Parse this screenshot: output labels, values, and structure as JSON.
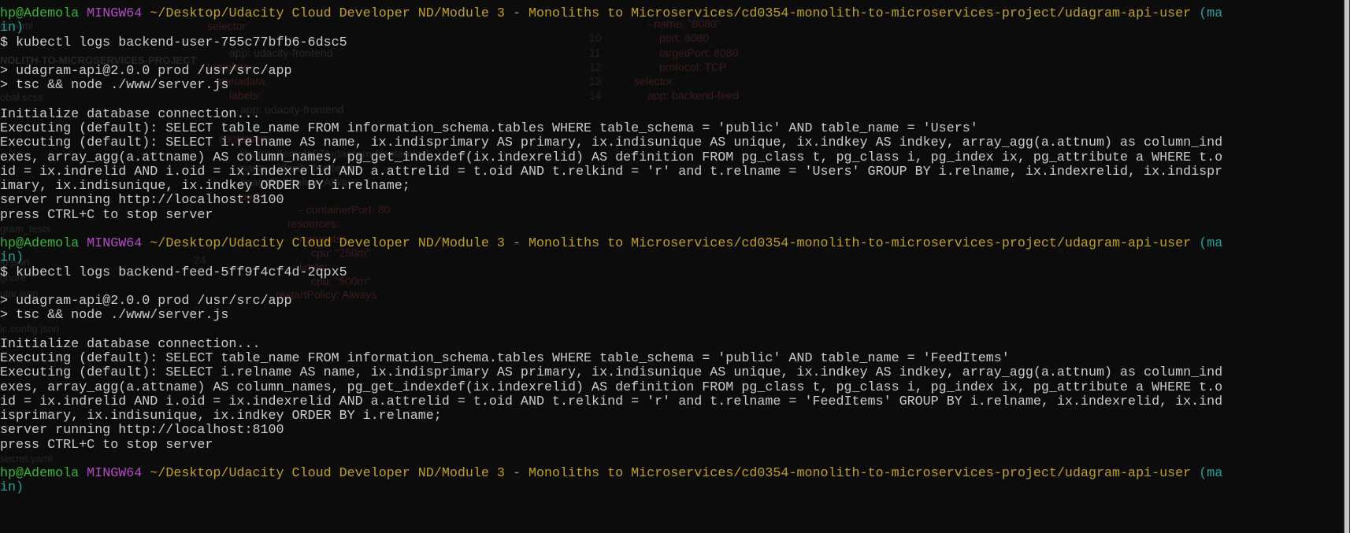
{
  "prompt": {
    "user": "hp@Ademola",
    "system": "MINGW64",
    "path": "~/Desktop/Udacity Cloud Developer ND/Module 3 - Monoliths to Microservices/cd0354-monolith-to-microservices-project/udagram-api-user",
    "branch_start": "(ma",
    "branch_end": "in)"
  },
  "sessions": [
    {
      "command": "$ kubectl logs backend-user-755c77bfb6-6dsc5",
      "npm_line1": "> udagram-api@2.0.0 prod /usr/src/app",
      "npm_line2": "> tsc && node ./www/server.js",
      "init": "Initialize database connection...",
      "exec1": "Executing (default): SELECT table_name FROM information_schema.tables WHERE table_schema = 'public' AND table_name = 'Users'",
      "exec2": [
        "Executing (default): SELECT i.relname AS name, ix.indisprimary AS primary, ix.indisunique AS unique, ix.indkey AS indkey, array_agg(a.attnum) as column_ind",
        "exes, array_agg(a.attname) AS column_names, pg_get_indexdef(ix.indexrelid) AS definition FROM pg_class t, pg_class i, pg_index ix, pg_attribute a WHERE t.o",
        "id = ix.indrelid AND i.oid = ix.indexrelid AND a.attrelid = t.oid AND t.relkind = 'r' and t.relname = 'Users' GROUP BY i.relname, ix.indexrelid, ix.indispr",
        "imary, ix.indisunique, ix.indkey ORDER BY i.relname;"
      ],
      "server": "server running http://localhost:8100",
      "stop": "press CTRL+C to stop server"
    },
    {
      "command": "$ kubectl logs backend-feed-5ff9f4cf4d-2qpx5",
      "npm_line1": "> udagram-api@2.0.0 prod /usr/src/app",
      "npm_line2": "> tsc && node ./www/server.js",
      "init": "Initialize database connection...",
      "exec1": "Executing (default): SELECT table_name FROM information_schema.tables WHERE table_schema = 'public' AND table_name = 'FeedItems'",
      "exec2": [
        "Executing (default): SELECT i.relname AS name, ix.indisprimary AS primary, ix.indisunique AS unique, ix.indkey AS indkey, array_agg(a.attnum) as column_ind",
        "exes, array_agg(a.attname) AS column_names, pg_get_indexdef(ix.indexrelid) AS definition FROM pg_class t, pg_class i, pg_index ix, pg_attribute a WHERE t.o",
        "id = ix.indrelid AND i.oid = ix.indexrelid AND a.attrelid = t.oid AND t.relkind = 'r' and t.relname = 'FeedItems' GROUP BY i.relname, ix.indexrelid, ix.ind",
        "isprimary, ix.indisunique, ix.indkey ORDER BY i.relname;"
      ],
      "server": "server running http://localhost:8100",
      "stop": "press CTRL+C to stop server"
    }
  ],
  "background_editor": {
    "sidebar": [
      "et.yaml",
      "NOLITH-TO-MICROSERVICES-PROJECT",
      "obal.scss",
      "gram_tests",
      "ig.json",
      "gnore",
      "ular.json",
      "ic.config.json",
      "secret.yaml"
    ],
    "left_code": [
      "selector:",
      "app: udacity-frontend",
      "template:",
      "metadata:",
      "labels:",
      "app: udacity-frontend",
      "containers:",
      "image: demola07/udagram-frontend:v1",
      "name: udacity-frontend",
      "imagePullPolicy: Always",
      "ports:",
      "- containerPort: 80",
      "resources:",
      "requests:",
      "cpu: \"250m\"",
      "limits:",
      "cpu: \"500m\"",
      "restartPolicy: Always",
      "24"
    ],
    "right_code": [
      "- name: \"8080\"",
      "port: 8080",
      "targetPort: 8080",
      "protocol: TCP",
      "selector:",
      "app: backend-feed"
    ],
    "line_numbers": [
      "10",
      "11",
      "12",
      "13",
      "14"
    ]
  }
}
